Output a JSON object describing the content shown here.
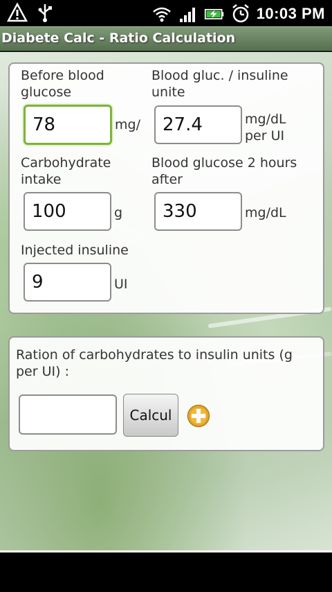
{
  "status_bar": {
    "time": "10:03 PM",
    "icons": [
      "warning-icon",
      "usb-icon",
      "wifi-icon",
      "signal-icon",
      "battery-icon",
      "alarm-icon"
    ]
  },
  "title_bar": {
    "title": "Diabete Calc - Ratio Calculation"
  },
  "form": {
    "before_glucose": {
      "label": "Before blood glucose",
      "value": "78",
      "unit": "mg/"
    },
    "gluc_per_unit": {
      "label": "Blood gluc. / insuline unite",
      "value": "27.4",
      "unit_line1": "mg/dL",
      "unit_line2": "per UI"
    },
    "carb_intake": {
      "label": "Carbohydrate intake",
      "value": "100",
      "unit": "g"
    },
    "after_glucose": {
      "label": "Blood glucose 2 hours after",
      "value": "330",
      "unit": "mg/dL"
    },
    "injected_insuline": {
      "label": "Injected insuline",
      "value": "9",
      "unit": "UI"
    }
  },
  "result": {
    "label": "Ration of carbohydrates to insulin units (g per UI) :",
    "value": "",
    "button_label": "Calcul",
    "add_icon": "plus-circle-icon"
  },
  "colors": {
    "title_bar": "#6b8764",
    "focus_border": "#7fb33a",
    "add_icon": "#e0a020"
  }
}
